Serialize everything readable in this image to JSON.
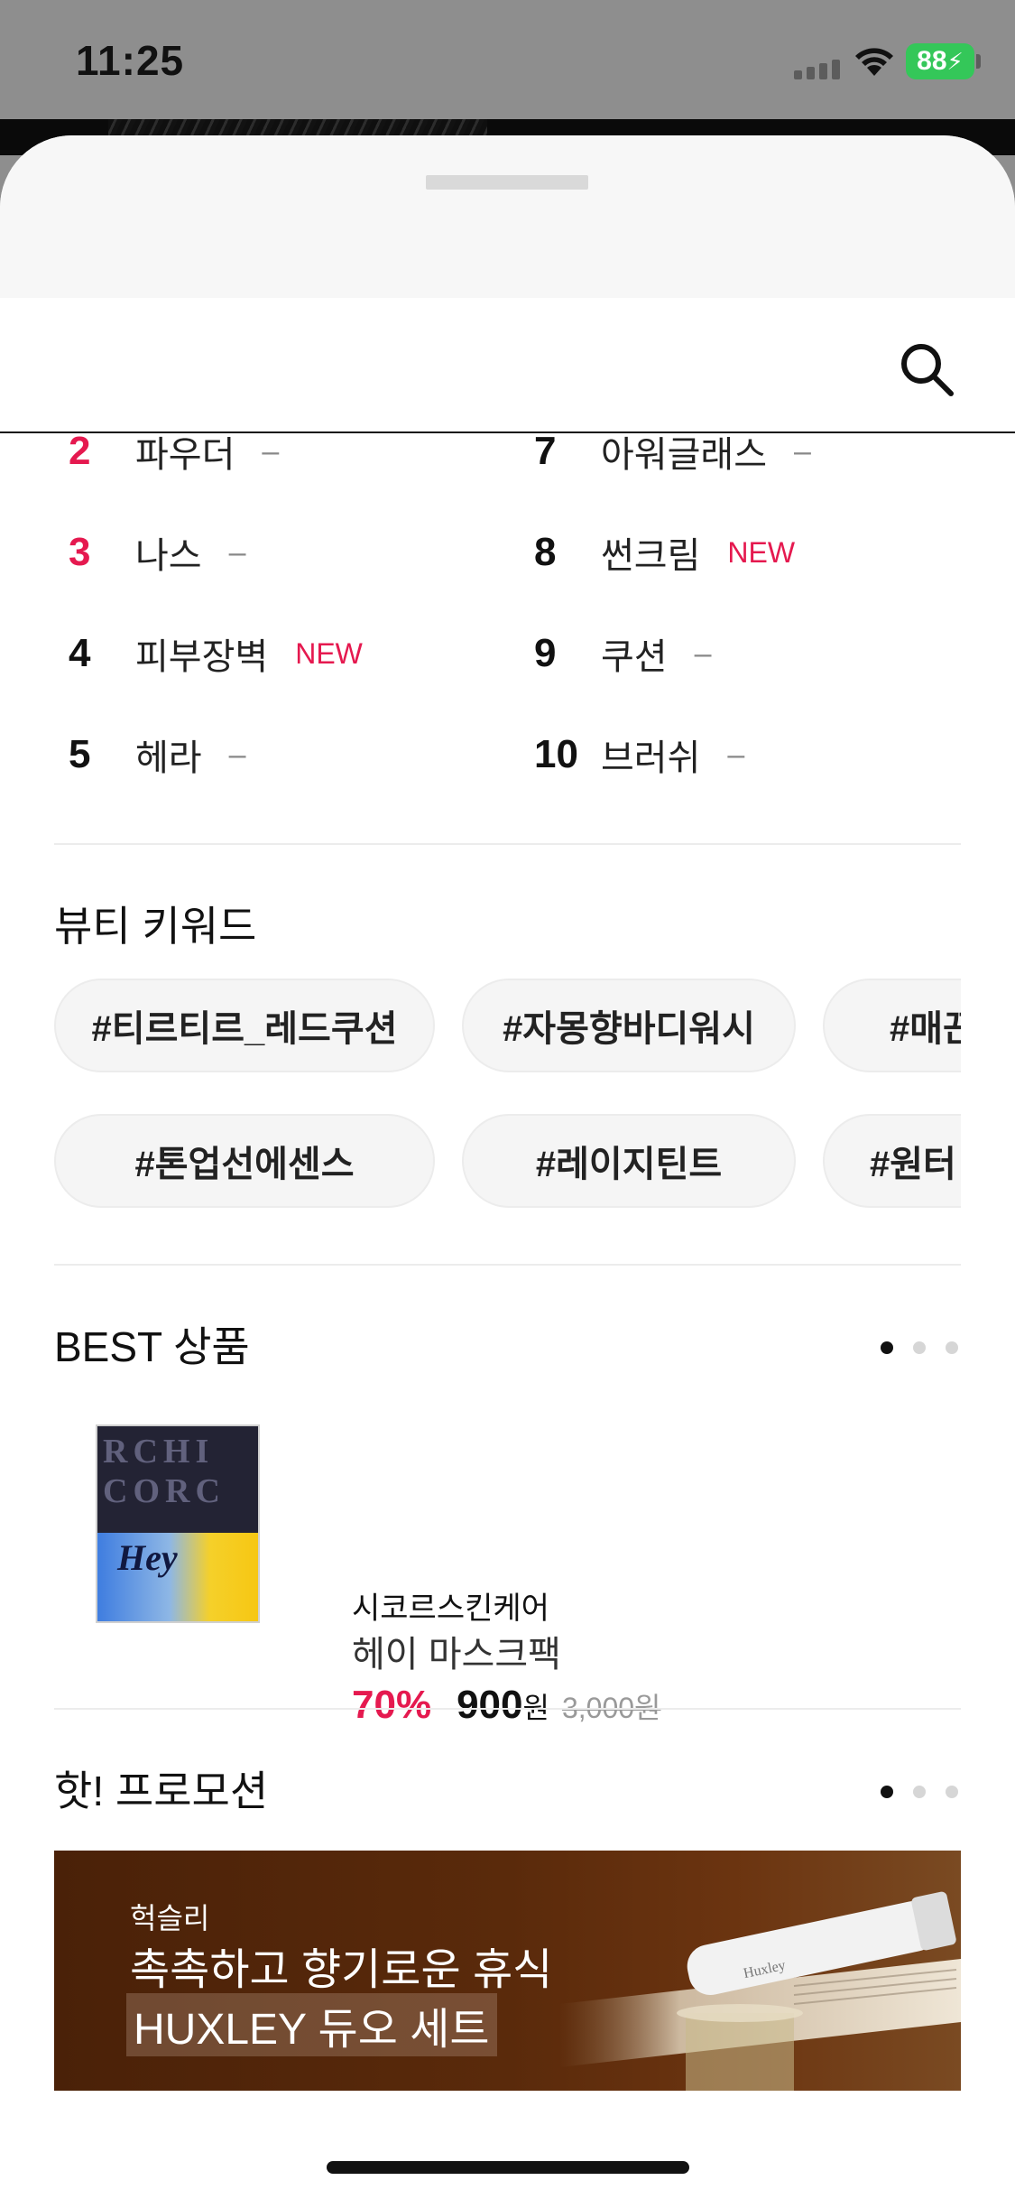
{
  "status_bar": {
    "time": "11:25",
    "battery": "88"
  },
  "search": {
    "icon": "search-icon"
  },
  "ranking": {
    "left": [
      {
        "rank": "2",
        "label": "파우더",
        "badge": "–",
        "hot": true
      },
      {
        "rank": "3",
        "label": "나스",
        "badge": "–",
        "hot": true
      },
      {
        "rank": "4",
        "label": "피부장벽",
        "badge": "NEW",
        "hot": false
      },
      {
        "rank": "5",
        "label": "헤라",
        "badge": "–",
        "hot": false
      }
    ],
    "right": [
      {
        "rank": "7",
        "label": "아워글래스",
        "badge": "–",
        "hot": false
      },
      {
        "rank": "8",
        "label": "썬크림",
        "badge": "NEW",
        "hot": false
      },
      {
        "rank": "9",
        "label": "쿠션",
        "badge": "–",
        "hot": false
      },
      {
        "rank": "10",
        "label": "브러쉬",
        "badge": "–",
        "hot": false
      }
    ]
  },
  "beauty_keywords": {
    "title": "뷰티 키워드",
    "row1": [
      "#티르티르_레드쿠션",
      "#자몽향바디워시",
      "#매끈"
    ],
    "row2": [
      "#톤업선에센스",
      "#레이지틴트",
      "#원터"
    ]
  },
  "best_products": {
    "title": "BEST 상품",
    "thumb_text": "Hey",
    "brand": "시코르스킨케어",
    "name": "헤이 마스크팩",
    "discount": "70%",
    "price": "900",
    "price_unit": "원",
    "original_price": "3,000원",
    "page_count": 3,
    "active_page": 0
  },
  "promotion": {
    "title": "핫! 프로모션",
    "brand": "헉슬리",
    "line1": "촉촉하고 향기로운 휴식",
    "line2": "HUXLEY 듀오 세트",
    "product_label": "Huxley",
    "page_count": 3,
    "active_page": 0
  },
  "colors": {
    "accent": "#e5194f",
    "banner_bg": "#5a2a0b"
  }
}
